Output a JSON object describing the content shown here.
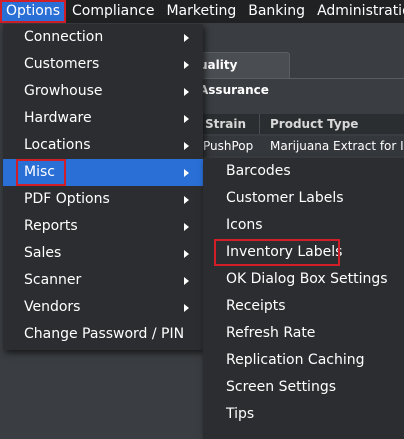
{
  "menubar": {
    "items": [
      "Options",
      "Compliance",
      "Marketing",
      "Banking",
      "Administration"
    ]
  },
  "background": {
    "tab_label": "uality Assurance",
    "table_headers": [
      "Strain",
      "Product Type"
    ],
    "row": [
      "PushPop",
      "Marijuana Extract for Inha"
    ]
  },
  "options_menu": {
    "items": [
      {
        "label": "Connection",
        "submenu": true
      },
      {
        "label": "Customers",
        "submenu": true
      },
      {
        "label": "Growhouse",
        "submenu": true
      },
      {
        "label": "Hardware",
        "submenu": true
      },
      {
        "label": "Locations",
        "submenu": true
      },
      {
        "label": "Misc",
        "submenu": true
      },
      {
        "label": "PDF Options",
        "submenu": true
      },
      {
        "label": "Reports",
        "submenu": true
      },
      {
        "label": "Sales",
        "submenu": true
      },
      {
        "label": "Scanner",
        "submenu": true
      },
      {
        "label": "Vendors",
        "submenu": true
      },
      {
        "label": "Change Password / PIN",
        "submenu": false
      }
    ],
    "highlighted": "Misc"
  },
  "misc_submenu": {
    "items": [
      "Barcodes",
      "Customer Labels",
      "Icons",
      "Inventory Labels",
      "OK Dialog Box Settings",
      "Receipts",
      "Refresh Rate",
      "Replication Caching",
      "Screen Settings",
      "Tips"
    ],
    "highlighted": "Inventory Labels"
  },
  "colors": {
    "menu_bg": "#2b2d30",
    "highlight": "#2a6fd6",
    "annotation_red": "#d11f2a"
  }
}
